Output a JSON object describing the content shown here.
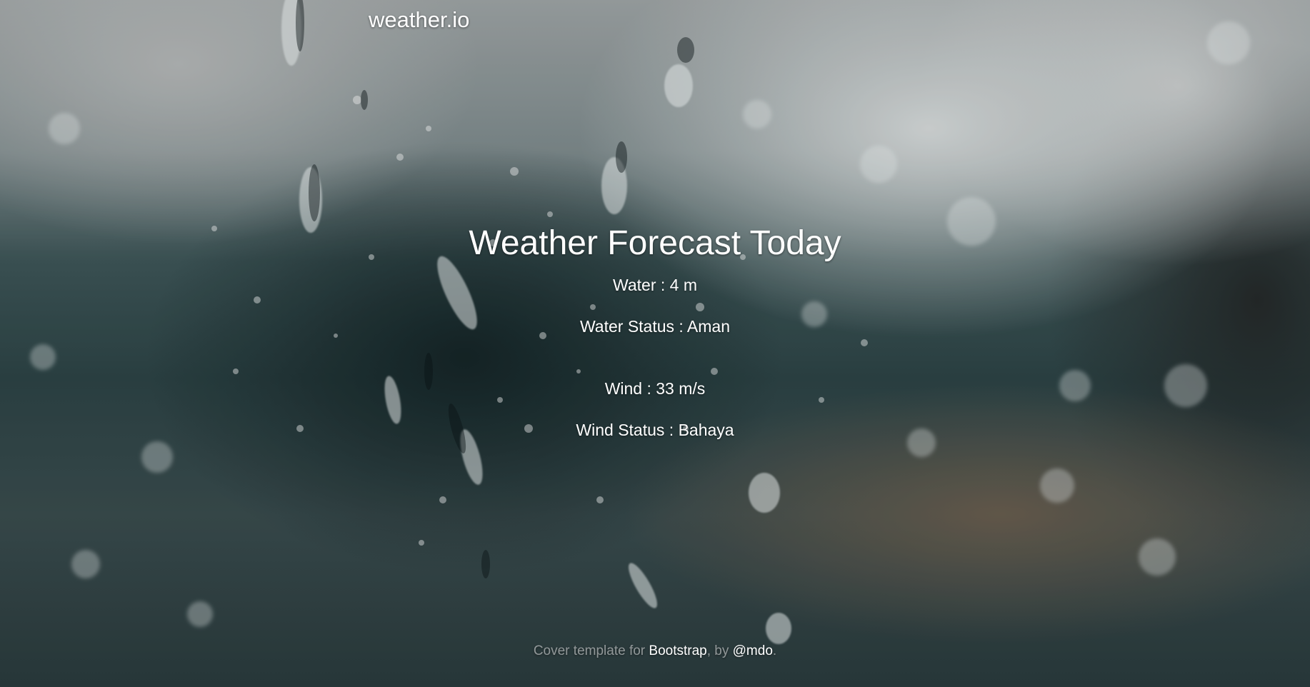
{
  "header": {
    "brand": "weather.io"
  },
  "main": {
    "title": "Weather Forecast Today",
    "water": "Water : 4 m",
    "water_status": "Water Status : Aman",
    "wind": "Wind : 33 m/s",
    "wind_status": "Wind Status : Bahaya"
  },
  "footer": {
    "prefix": "Cover template for ",
    "bootstrap_link": "Bootstrap",
    "middle": ", by ",
    "author_link": "@mdo",
    "suffix": "."
  },
  "background": {
    "image": "rain-drops-on-window"
  }
}
